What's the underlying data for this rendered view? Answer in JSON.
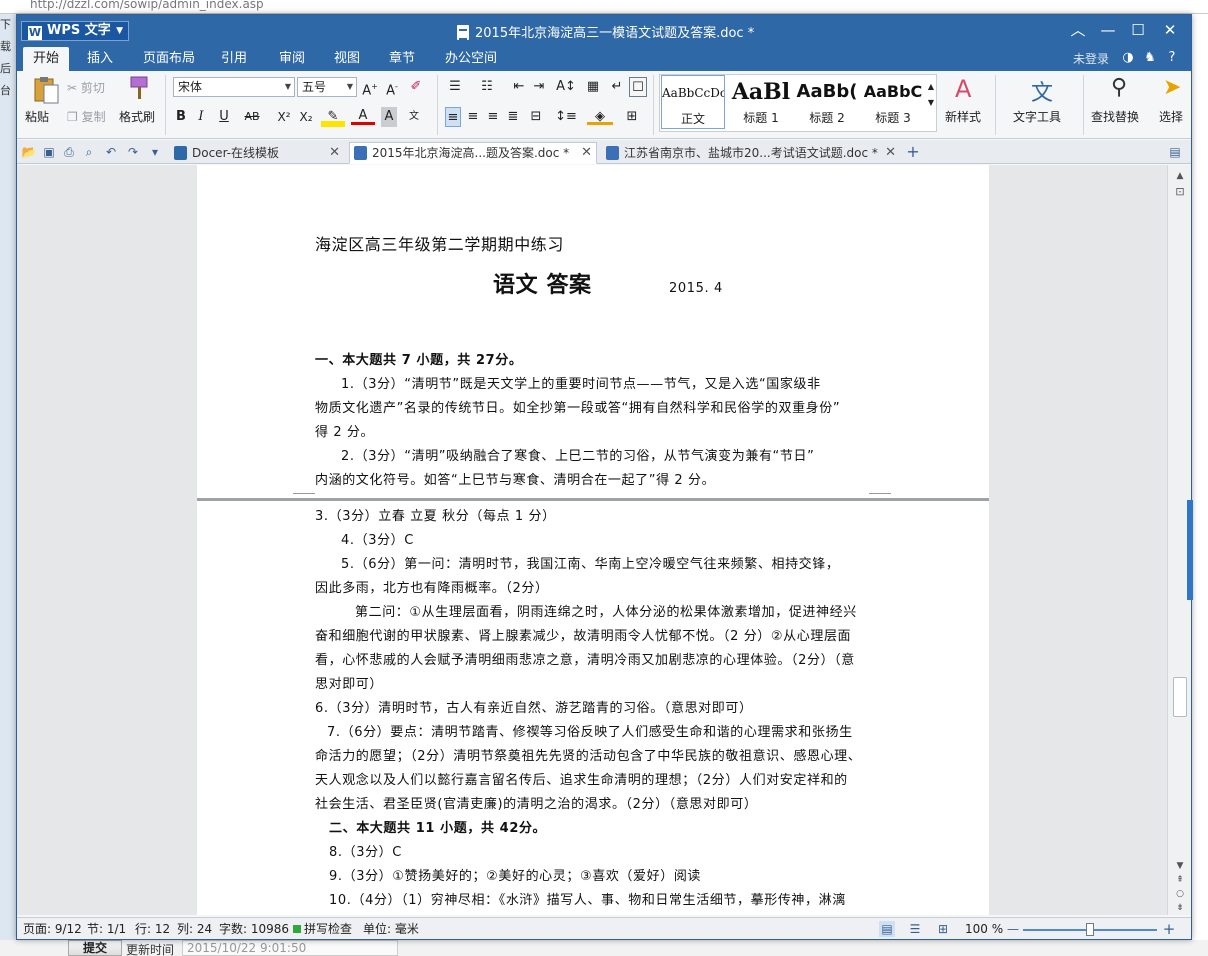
{
  "background": {
    "url": "http://dzzl.com/sowip/admin_index.asp",
    "left_labels": [
      "下载",
      "后台"
    ],
    "submit_label": "提交",
    "update_label": "更新时间",
    "update_value": "2015/10/22 9:01:50"
  },
  "window": {
    "app_name": "WPS 文字",
    "title": "2015年北京海淀高三一模语文试题及答案.doc *",
    "colors": {
      "titlebar": "#2f68a6",
      "accent": "#2f76c8"
    }
  },
  "menu": {
    "tabs": [
      "开始",
      "插入",
      "页面布局",
      "引用",
      "审阅",
      "视图",
      "章节",
      "办公空间"
    ],
    "active_tab": "开始",
    "login_label": "未登录"
  },
  "ribbon": {
    "paste": "粘贴",
    "cut": "剪切",
    "copy": "复制",
    "format_painter": "格式刷",
    "font_name": "宋体",
    "font_size": "五号",
    "styles": [
      {
        "preview": "AaBbCcDc",
        "label": "正文"
      },
      {
        "preview": "AaBl",
        "label": "标题 1"
      },
      {
        "preview": "AaBb(",
        "label": "标题 2"
      },
      {
        "preview": "AaBbC",
        "label": "标题 3"
      }
    ],
    "new_style": "新样式",
    "text_tools": "文字工具",
    "find_replace": "查找替换",
    "select": "选择"
  },
  "doc_tabs": [
    {
      "label": "Docer-在线模板",
      "icon": "docer-icon"
    },
    {
      "label": "2015年北京海淀高...题及答案.doc *",
      "icon": "wps-doc-icon",
      "active": true
    },
    {
      "label": "江苏省南京市、盐城市20...考试语文试题.doc *",
      "icon": "wps-doc-icon"
    }
  ],
  "document": {
    "page1": {
      "header": "海淀区高三年级第二学期期中练习",
      "title": "语文  答案",
      "date": "2015. 4",
      "section1": "一、本大题共 7 小题，共 27分。",
      "q1_line1": "1.（3分）“清明节”既是天文学上的重要时间节点——节气，又是入选“国家级非",
      "q1_line2": "物质文化遗产”名录的传统节日。如全抄第一段或答“拥有自然科学和民俗学的双重身份”",
      "q1_line3": "得 2 分。",
      "q2_line1": "2.（3分）“清明”吸纳融合了寒食、上巳二节的习俗，从节气演变为兼有“节日”",
      "q2_line2": "内涵的文化符号。如答“上巳节与寒食、清明合在一起了”得 2 分。"
    },
    "page2": {
      "q3": "3.（3分）立春  立夏  秋分（每点 1 分）",
      "q4": "4.（3分）C",
      "q5_line1": "5.（6分）第一问：清明时节，我国江南、华南上空冷暖空气往来频繁、相持交锋，",
      "q5_line2": "因此多雨，北方也有降雨概率。（2分）",
      "q5_line3": "第二问：①从生理层面看，阴雨连绵之时，人体分泌的松果体激素增加，促进神经兴",
      "q5_line4": "奋和细胞代谢的甲状腺素、肾上腺素减少，故清明雨令人忧郁不悦。（2 分）②从心理层面",
      "q5_line5": "看，心怀悲戚的人会赋予清明细雨悲凉之意，清明冷雨又加剧悲凉的心理体验。（2分）（意",
      "q5_line6": "思对即可）",
      "q6": "6.（3分）清明时节，古人有亲近自然、游艺踏青的习俗。（意思对即可）",
      "q7_line1": "7.（6分）要点：清明节踏青、修禊等习俗反映了人们感受生命和谐的心理需求和张扬生",
      "q7_line2": "命活力的愿望；（2分）清明节祭奠祖先先贤的活动包含了中华民族的敬祖意识、感恩心理、",
      "q7_line3": "天人观念以及人们以懿行嘉言留名传后、追求生命清明的理想；（2分）人们对安定祥和的",
      "q7_line4": "社会生活、君圣臣贤(官清吏廉)的清明之治的渴求。（2分）（意思对即可）",
      "section2": "二、本大题共 11 小题，共 42分。",
      "q8": "8.（3分）C",
      "q9": "9.（3分）①赞扬美好的；②美好的心灵；③喜欢（爱好）阅读",
      "q10": "10.（4分）（1）穷神尽相：《水浒》描写人、事、物和日常生活细节，摹形传神，淋漓"
    }
  },
  "status": {
    "page": "页面: 9/12",
    "section": "节: 1/1",
    "row": "行: 12",
    "col": "列: 24",
    "words": "字数: 10986",
    "spell": "拼写检查",
    "unit": "单位: 毫米",
    "zoom": "100 %",
    "zoom_fraction": 0.5
  }
}
